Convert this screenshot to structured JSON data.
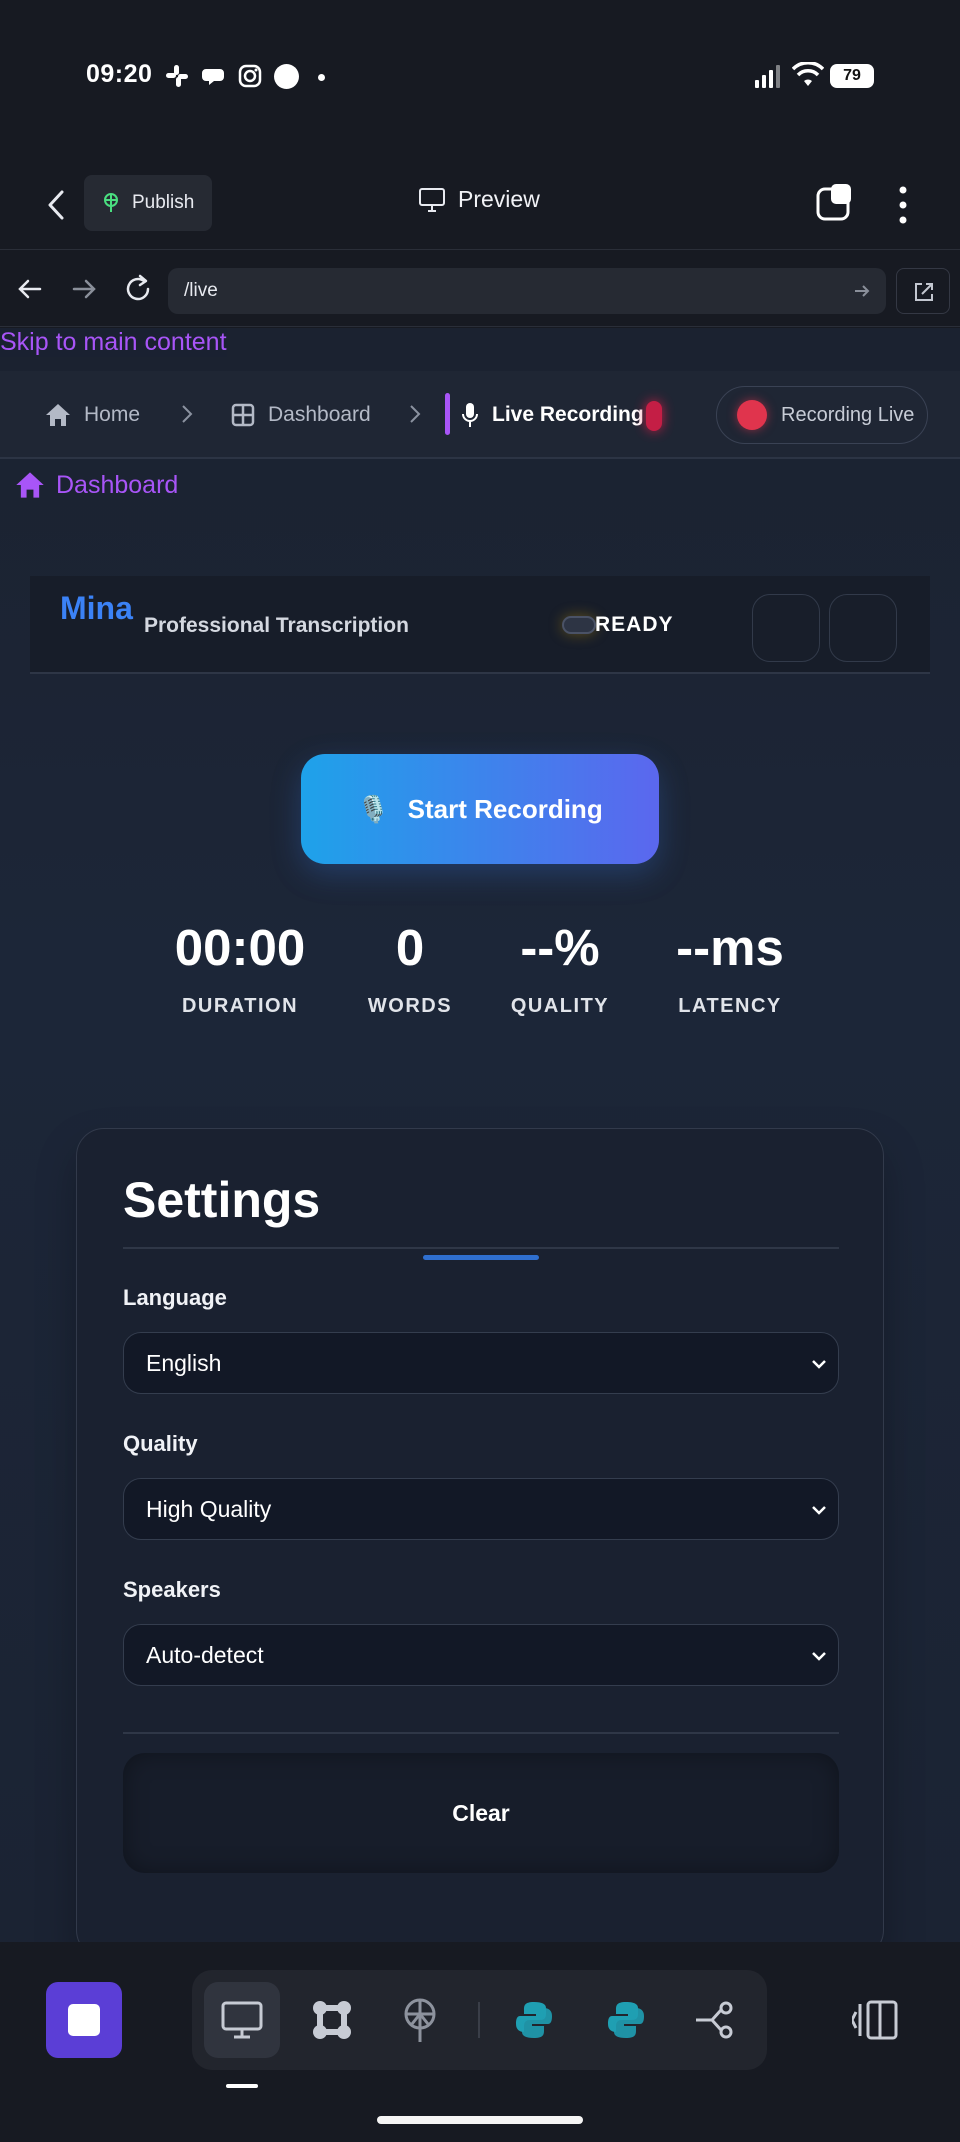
{
  "status_bar": {
    "time": "09:20",
    "battery": "79"
  },
  "app_toolbar": {
    "publish_label": "Publish",
    "preview_label": "Preview"
  },
  "browser": {
    "url": "/live"
  },
  "page": {
    "skip_link": "Skip to main content",
    "breadcrumbs": [
      {
        "label": "Home",
        "icon": "home-icon"
      },
      {
        "label": "Dashboard",
        "icon": "grid-icon"
      },
      {
        "label": "Live Recording",
        "icon": "mic-icon",
        "active": true
      }
    ],
    "recording_live_label": "Recording Live",
    "home_link": "Dashboard",
    "header": {
      "brand": "Mina",
      "subtitle": "Professional Transcription",
      "status": "READY"
    },
    "start_button": {
      "icon": "🎙️",
      "label": "Start Recording"
    },
    "stats": [
      {
        "value": "00:00",
        "label": "DURATION"
      },
      {
        "value": "0",
        "label": "WORDS"
      },
      {
        "value": "--%",
        "label": "QUALITY"
      },
      {
        "value": "--ms",
        "label": "LATENCY"
      }
    ],
    "settings": {
      "title": "Settings",
      "fields": [
        {
          "label": "Language",
          "value": "English"
        },
        {
          "label": "Quality",
          "value": "High Quality"
        },
        {
          "label": "Speakers",
          "value": "Auto-detect"
        }
      ],
      "clear_label": "Clear"
    }
  },
  "colors": {
    "accent_purple": "#a855f7",
    "brand_blue": "#3b82f6",
    "record_red": "#e0344d",
    "stop_purple": "#5b3ed6"
  }
}
